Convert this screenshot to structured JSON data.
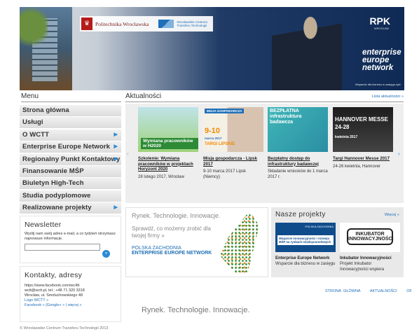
{
  "header": {
    "university": "Politechnika Wrocławska",
    "wctt": "Wrocławskie Centrum Transferu Technologii",
    "rpk": "RPK",
    "rpk_sub": "WROCŁAW",
    "een": "enterprise europe network",
    "een_tag": "Wsparcie dla biznesu w zasięgu ręki"
  },
  "menu": {
    "title": "Menu",
    "items": [
      {
        "label": "Strona główna",
        "sub": false
      },
      {
        "label": "Usługi",
        "sub": false
      },
      {
        "label": "O WCTT",
        "sub": true
      },
      {
        "label": "Enterprise Europe Network",
        "sub": true
      },
      {
        "label": "Regionalny Punkt Kontaktowy",
        "sub": true
      },
      {
        "label": "Finansowanie MŚP",
        "sub": false
      },
      {
        "label": "Biuletyn High-Tech",
        "sub": false
      },
      {
        "label": "Studia podyplomowe",
        "sub": false
      },
      {
        "label": "Realizowane projekty",
        "sub": true
      }
    ]
  },
  "newsletter": {
    "title": "Newsletter",
    "desc": "Wyślij nam swój adres e-mail, a co tydzień otrzymasz najnowsze informacje.",
    "input_value": "",
    "go": "»"
  },
  "contact": {
    "title": "Kontakty, adresy",
    "lines": [
      {
        "text": "https://www.facebook.com/wc4tt",
        "blue": false
      },
      {
        "text": "wctt@wctt.pl, tel.: +48 71 320 3318",
        "blue": false
      },
      {
        "text": "Wrocław, ul. Smoluchowskiego 48",
        "blue": false
      },
      {
        "text": "Logo WCTT »",
        "blue": true
      },
      {
        "text": "Facebook » |Google+ » | więcej »",
        "blue": true
      }
    ]
  },
  "footer": {
    "copy": "© Wrocławskie Centrum Transferu Technologii 2013"
  },
  "news": {
    "title": "Aktualności",
    "more": "Lista aktualności »",
    "prev": "‹",
    "next": "›",
    "items": [
      {
        "title": "Szkolenie: Wymiana pracowników w projektach Horyzont 2020",
        "date": "28 lutego 2017, Wrocław",
        "overlay": "Wymiana pracowników w H2020",
        "color": "#ffffff"
      },
      {
        "title": "Misja gospodarcza - Lipsk 2017",
        "date": "9-10 marca 2017 Lipsk (Niemcy)",
        "overlay": "MISJA GOSPODARCZA",
        "color": "#1e6fb8"
      },
      {
        "title": "Bezpłatny dostęp do infrastruktury badawczej",
        "date": "Składanie wniosków do 1 marca 2017 r.",
        "overlay": "BEZPŁATNA infrastruktura badawcza",
        "color": "#ffffff"
      },
      {
        "title": "Targi Hannover Messe 2017",
        "date": "24-26 kwietnia, Hannover",
        "overlay": "HANNOVER MESSE 24-28",
        "color": "#ffffff"
      }
    ],
    "n2_big": "9-10",
    "n2_sub": "marca 2017",
    "n2_targi": "TARGI LIPSKIE",
    "n4_month": "kwietnia 2017"
  },
  "promo": {
    "heading": "Rynek. Technologie. Innowacje.",
    "sub": "Sprawdź, co możemy zrobić dla twojej firmy »",
    "pz": "POLSKA ZACHODNIA",
    "een": "ENTERPRISE EUROPE NETWORK"
  },
  "projects": {
    "title": "Nasze projekty",
    "more": "Więcej »",
    "p1_text": "Wsparcie innowacyjności i rozwoju MŚP na rynkach międzynarodowych",
    "p1_badge": "POLSKA ZACHODNIA",
    "p2_text": "INKUBATOR INNOWACYJNOŚCI",
    "cards": [
      {
        "title": "Enterprise Europe Network",
        "desc": "Wsparcie dla biznesu w zasięgu"
      },
      {
        "title": "Inkubator Innowacyjności",
        "desc": "Projekt Inkubator Innowacyjności wspiera"
      }
    ]
  },
  "bottom": {
    "nav": [
      "STRONA GŁÓWNA",
      "AKTUALNOŚCI",
      "OF"
    ],
    "heading": "Rynek. Technologie. Innowacje."
  }
}
